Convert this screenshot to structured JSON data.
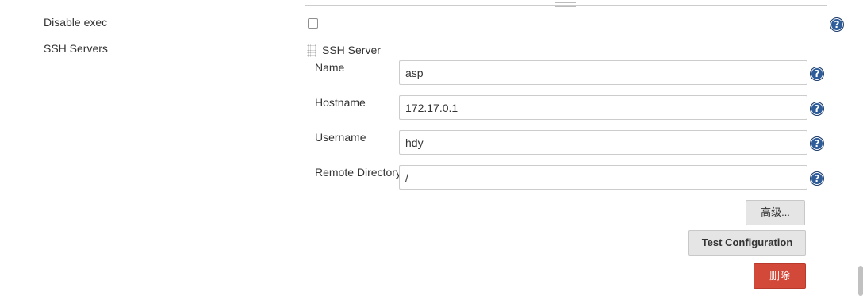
{
  "disable_exec": {
    "label": "Disable exec",
    "checked": false
  },
  "ssh_servers": {
    "label": "SSH Servers",
    "server": {
      "title": "SSH Server",
      "fields": {
        "name": {
          "label": "Name",
          "value": "asp"
        },
        "hostname": {
          "label": "Hostname",
          "value": "172.17.0.1"
        },
        "username": {
          "label": "Username",
          "value": "hdy"
        },
        "remote_directory": {
          "label": "Remote Directory",
          "value": "/"
        }
      },
      "advanced_label": "高级...",
      "test_label": "Test Configuration",
      "delete_label": "删除"
    }
  },
  "help_icon_glyph": "?",
  "colors": {
    "danger": "#d24939",
    "help": "#2f5d9a",
    "button_bg": "#e5e5e5"
  }
}
